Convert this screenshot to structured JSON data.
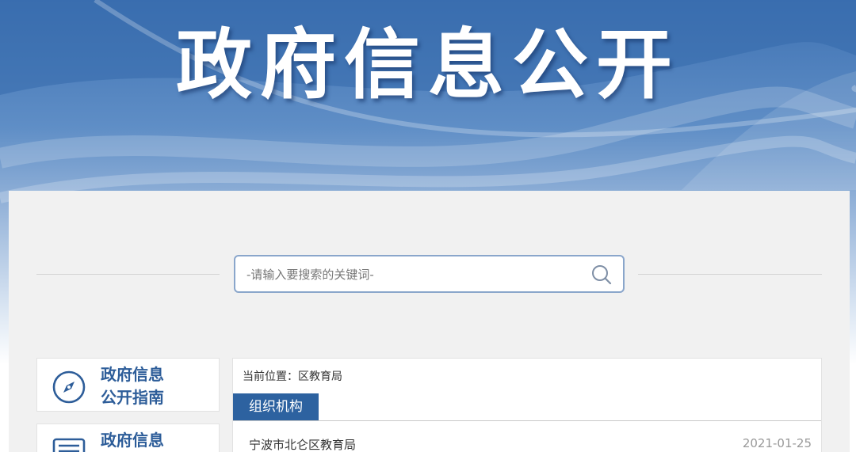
{
  "banner": {
    "title": "政府信息公开"
  },
  "search": {
    "placeholder": "-请输入要搜索的关键词-"
  },
  "sidebar": {
    "items": [
      {
        "label_line1": "政府信息",
        "label_line2": "公开指南",
        "icon": "compass-icon"
      },
      {
        "label_line1": "政府信息",
        "label_line2": "",
        "icon": "document-list-icon"
      }
    ]
  },
  "content": {
    "breadcrumb": "当前位置：区教育局",
    "tab": "组织机构",
    "items": [
      {
        "title": "宁波市北仑区教育局",
        "date": "2021-01-25"
      }
    ]
  },
  "colors": {
    "accent": "#2d62a0",
    "banner": "#4a7dbd"
  }
}
